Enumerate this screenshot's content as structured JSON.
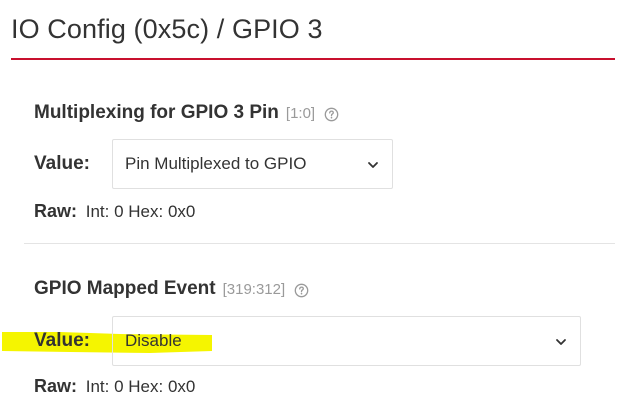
{
  "header": {
    "title": "IO Config (0x5c) / GPIO 3",
    "accent_color": "#c8102e"
  },
  "sections": [
    {
      "title": "Multiplexing for GPIO 3 Pin",
      "bit_range": "[1:0]",
      "help_icon": "question-circle-icon",
      "value_label": "Value:",
      "selected_value": "Pin Multiplexed to GPIO",
      "raw_label": "Raw:",
      "raw_text": "Int: 0 Hex: 0x0"
    },
    {
      "title": "GPIO Mapped Event",
      "bit_range": "[319:312]",
      "help_icon": "question-circle-icon",
      "value_label": "Value:",
      "selected_value": "Disable",
      "raw_label": "Raw:",
      "raw_text": "Int: 0 Hex: 0x0",
      "highlight_color": "#f5f500"
    }
  ]
}
